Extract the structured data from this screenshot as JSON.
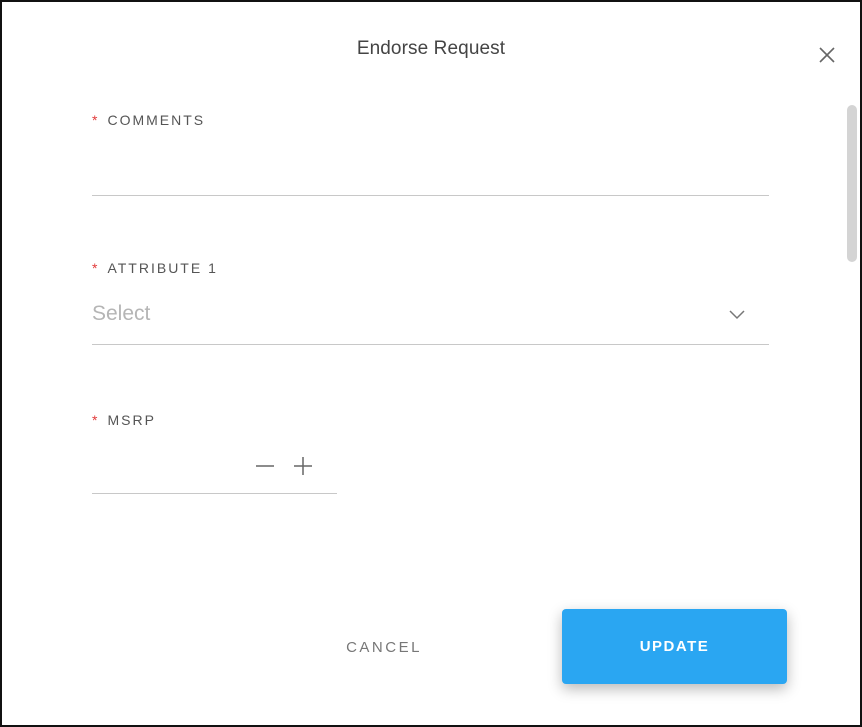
{
  "dialog": {
    "title": "Endorse Request",
    "close_icon": "close-icon"
  },
  "fields": {
    "comments": {
      "required_marker": "*",
      "label": "COMMENTS",
      "value": ""
    },
    "attribute1": {
      "required_marker": "*",
      "label": "ATTRIBUTE 1",
      "placeholder": "Select",
      "dropdown_icon": "chevron-down-icon"
    },
    "msrp": {
      "required_marker": "*",
      "label": "MSRP",
      "value": "",
      "decrement_icon": "minus-icon",
      "increment_icon": "plus-icon"
    }
  },
  "actions": {
    "cancel_label": "CANCEL",
    "update_label": "UPDATE"
  },
  "colors": {
    "required": "#e23b3b",
    "primary_button": "#2aa6f2",
    "label_text": "#555555",
    "placeholder_text": "#b5b5b5",
    "underline": "#c8c8c8",
    "scrollbar_thumb": "#d4d4d4"
  }
}
